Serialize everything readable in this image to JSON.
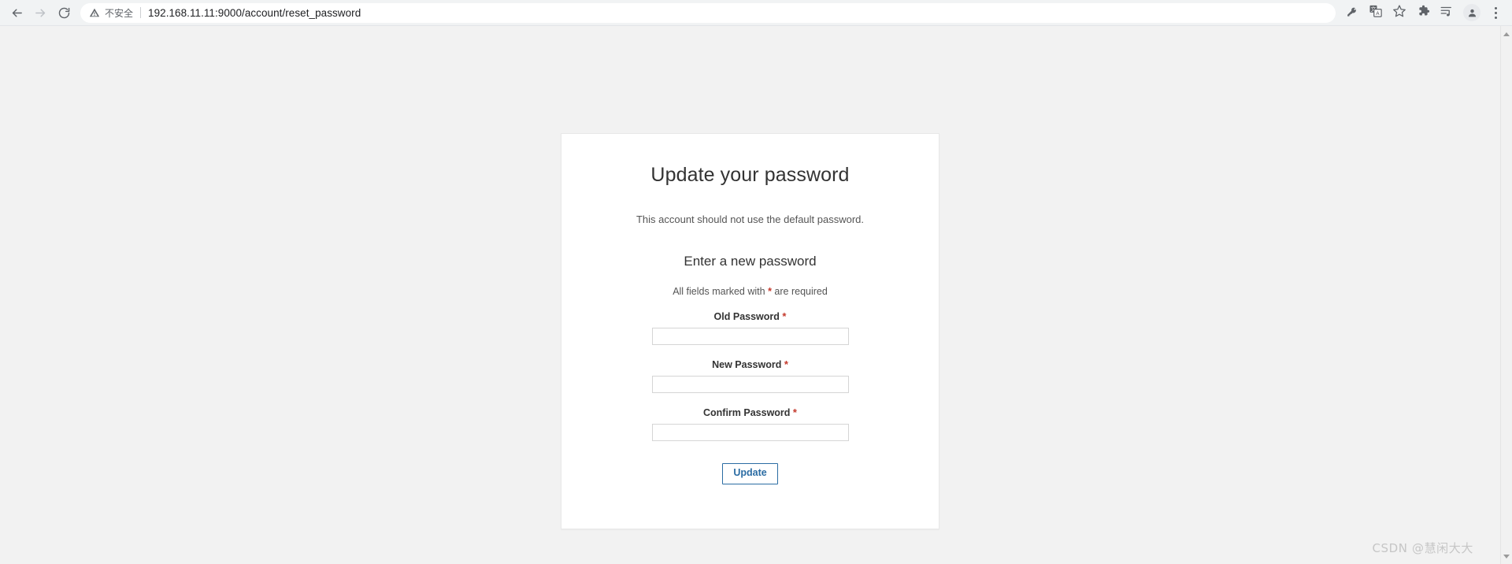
{
  "browser": {
    "nav": {
      "back_icon": "arrow-left-icon",
      "forward_icon": "arrow-right-icon",
      "reload_icon": "reload-icon"
    },
    "omnibox": {
      "security_label": "不安全",
      "security_icon": "warning-triangle-icon",
      "url": "192.168.11.11:9000/account/reset_password"
    },
    "toolbar_icons": [
      {
        "name": "password-key-icon",
        "glyph": "key"
      },
      {
        "name": "translate-icon",
        "glyph": "translate"
      },
      {
        "name": "bookmark-star-icon",
        "glyph": "star"
      },
      {
        "name": "extensions-puzzle-icon",
        "glyph": "puzzle"
      },
      {
        "name": "reading-list-icon",
        "glyph": "reading-list"
      },
      {
        "name": "profile-avatar-icon",
        "glyph": "avatar"
      },
      {
        "name": "chrome-menu-icon",
        "glyph": "three-dots"
      }
    ]
  },
  "page": {
    "card": {
      "title": "Update your password",
      "subtitle": "This account should not use the default password.",
      "form_heading": "Enter a new password",
      "required_note_before": "All fields marked with ",
      "required_note_star": "*",
      "required_note_after": " are required",
      "fields": [
        {
          "name": "old-password",
          "label": "Old Password",
          "required_marker": "*",
          "value": "",
          "placeholder": "",
          "type": "password"
        },
        {
          "name": "new-password",
          "label": "New Password",
          "required_marker": "*",
          "value": "",
          "placeholder": "",
          "type": "password"
        },
        {
          "name": "confirm-password",
          "label": "Confirm Password",
          "required_marker": "*",
          "value": "",
          "placeholder": "",
          "type": "password"
        }
      ],
      "submit_label": "Update"
    },
    "watermark": "CSDN @慧闲大大"
  },
  "colors": {
    "page_background": "#f2f2f2",
    "card_background": "#ffffff",
    "toolbar_background": "#f1f3f4",
    "required_star": "#c4392c",
    "button_accent": "#2b6ca3",
    "title_text": "#333333"
  }
}
